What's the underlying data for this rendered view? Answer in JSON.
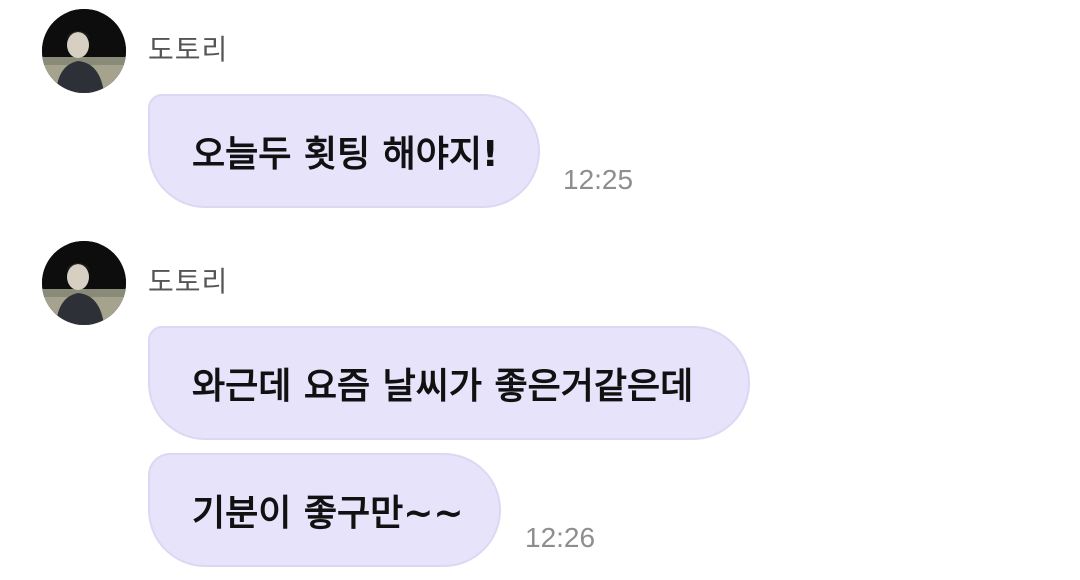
{
  "groups": [
    {
      "sender": "도토리",
      "messages": [
        {
          "text": "오늘두 횟팅 해야지!",
          "time": "12:25"
        }
      ]
    },
    {
      "sender": "도토리",
      "messages": [
        {
          "text": "와근데 요즘 날씨가 좋은거같은데",
          "time": ""
        },
        {
          "text": "기분이 좋구만~~",
          "time": "12:26"
        }
      ]
    }
  ],
  "colors": {
    "bubble_bg": "#e6e3fa",
    "bubble_border": "#dcd8f3",
    "sender_text": "#555555",
    "time_text": "#8e8e8e"
  }
}
